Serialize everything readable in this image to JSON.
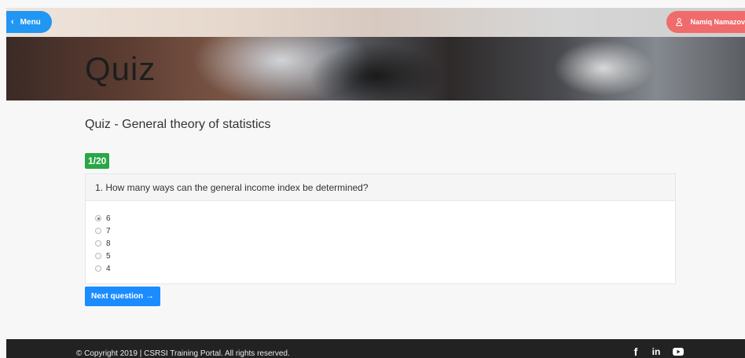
{
  "nav": {
    "menu_label": "Menu",
    "user_name": "Namiq Namazov"
  },
  "hero": {
    "title": "Quiz"
  },
  "quiz": {
    "heading": "Quiz - General theory of statistics",
    "counter": "1/20",
    "question": "1. How many ways can the general income index be determined?",
    "options": [
      "6",
      "7",
      "8",
      "5",
      "4"
    ],
    "selected_option": "6",
    "next_label": "Next question"
  },
  "footer": {
    "copyright": "© Copyright 2019 | CSRSI Training Portal. All rights reserved.",
    "social": [
      "facebook-icon",
      "linkedin-icon",
      "youtube-icon"
    ]
  },
  "colors": {
    "menu_button": "#2196f3",
    "user_button": "#f06b6b",
    "counter_badge": "#28a745",
    "next_button": "#1a8cff",
    "footer": "#222222"
  }
}
